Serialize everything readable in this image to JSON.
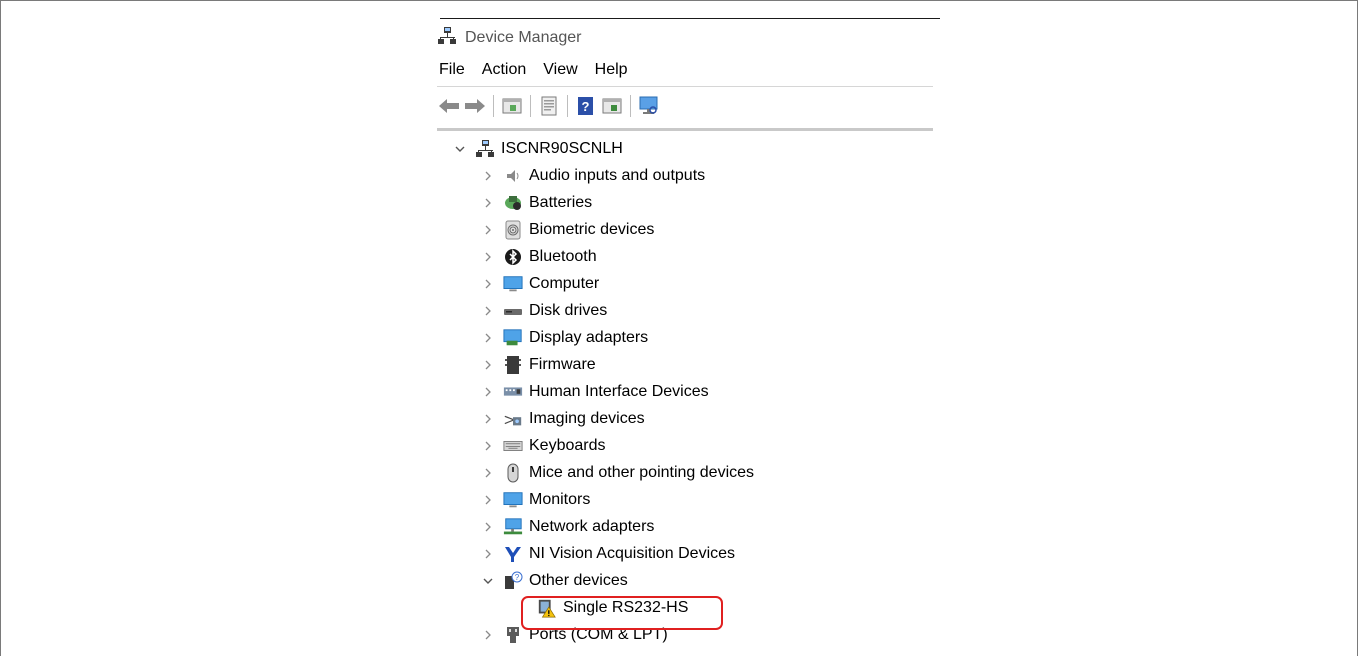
{
  "window": {
    "title": "Device Manager"
  },
  "menu": [
    "File",
    "Action",
    "View",
    "Help"
  ],
  "toolbar": [
    "back-icon",
    "forward-icon",
    "properties-icon",
    "update-driver-icon",
    "help-icon",
    "show-hidden-icon",
    "scan-hardware-icon"
  ],
  "tree": {
    "root": "ISCNR90SCNLH",
    "categories": [
      {
        "label": "Audio inputs and outputs",
        "icon": "speaker-icon"
      },
      {
        "label": "Batteries",
        "icon": "battery-icon"
      },
      {
        "label": "Biometric devices",
        "icon": "fingerprint-icon"
      },
      {
        "label": "Bluetooth",
        "icon": "bluetooth-icon"
      },
      {
        "label": "Computer",
        "icon": "computer-icon"
      },
      {
        "label": "Disk drives",
        "icon": "disk-drive-icon"
      },
      {
        "label": "Display adapters",
        "icon": "display-adapter-icon"
      },
      {
        "label": "Firmware",
        "icon": "firmware-icon"
      },
      {
        "label": "Human Interface Devices",
        "icon": "hid-icon"
      },
      {
        "label": "Imaging devices",
        "icon": "camera-icon"
      },
      {
        "label": "Keyboards",
        "icon": "keyboard-icon"
      },
      {
        "label": "Mice and other pointing devices",
        "icon": "mouse-icon"
      },
      {
        "label": "Monitors",
        "icon": "monitor-icon"
      },
      {
        "label": "Network adapters",
        "icon": "network-adapter-icon"
      },
      {
        "label": "NI Vision Acquisition Devices",
        "icon": "ni-vision-icon"
      },
      {
        "label": "Other devices",
        "icon": "unknown-device-icon",
        "expanded": true
      },
      {
        "label": "Single RS232-HS",
        "icon": "warning-device-icon",
        "child": true
      },
      {
        "label": "Ports (COM & LPT)",
        "icon": "port-icon"
      }
    ]
  },
  "colors": {
    "highlight": "#e02020",
    "icon_blue": "#1e88e5"
  }
}
